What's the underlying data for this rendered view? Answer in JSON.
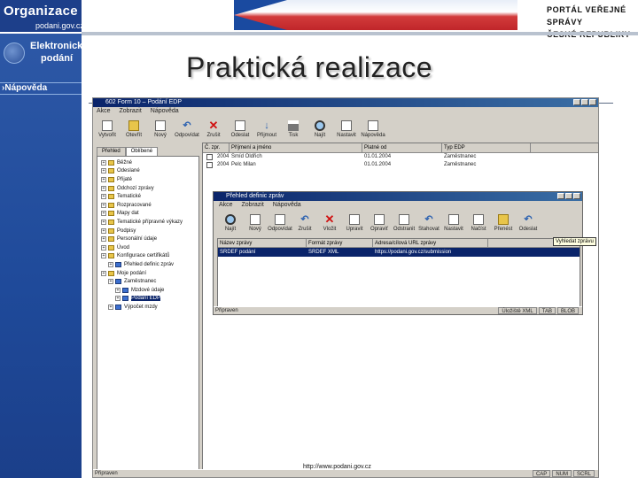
{
  "header": {
    "org_title": "Organizace",
    "org_domain": "podani.gov.cz",
    "portal_line1": "PORTÁL VEŘEJNÉ SPRÁVY",
    "portal_line2": "ČESKÉ REPUBLIKY"
  },
  "sidebar": {
    "app_name_line1": "Elektronická",
    "app_name_line2": "podání",
    "help_label": "Nápověda"
  },
  "slide": {
    "title": "Praktická realizace",
    "footer_url": "http://www.podani.gov.cz"
  },
  "main_window": {
    "title": "602 Form 10 – Podání EDP",
    "menu": [
      "Akce",
      "Zobrazit",
      "Nápověda"
    ],
    "toolbar": [
      "Vytvořit",
      "Otevřít",
      "Nový",
      "Odpovídat",
      "Zrušit",
      "Odeslat",
      "Přijmout",
      "Tisk",
      "Najít",
      "Nastavit",
      "Nápověda"
    ],
    "tabs": [
      "Přehled",
      "Oblíbené"
    ],
    "tree": [
      {
        "label": "Běžné",
        "level": 0
      },
      {
        "label": "Odeslané",
        "level": 0
      },
      {
        "label": "Přijaté",
        "level": 0
      },
      {
        "label": "Odchozí zprávy",
        "level": 0
      },
      {
        "label": "Tematické",
        "level": 0
      },
      {
        "label": "Rozpracované",
        "level": 0
      },
      {
        "label": "Mapy dat",
        "level": 0
      },
      {
        "label": "Tematické přípravné výkazy",
        "level": 0
      },
      {
        "label": "Podpisy",
        "level": 0
      },
      {
        "label": "Personální údaje",
        "level": 0
      },
      {
        "label": "Úvod",
        "level": 0
      },
      {
        "label": "Konfigurace certifikátů",
        "level": 0
      },
      {
        "label": "Přehled definic zpráv",
        "level": 1
      },
      {
        "label": "Moje podání",
        "level": 0
      },
      {
        "label": "Zaměstnanec",
        "level": 1
      },
      {
        "label": "Mzdové údaje",
        "level": 2
      },
      {
        "label": "Podání EDP",
        "level": 2,
        "selected": true
      },
      {
        "label": "Výpočet mzdy",
        "level": 1
      }
    ],
    "grid_headers": [
      "Č. zpr.",
      "Příjmení a jméno",
      "Platné od",
      "Typ EDP"
    ],
    "grid_rows": [
      [
        "2004",
        "Šmíd Oldřich",
        "01.01.2004",
        "Zaměstnanec"
      ],
      [
        "2004",
        "Pelc Milan",
        "01.01.2004",
        "Zaměstnanec"
      ]
    ],
    "status": "Připraven",
    "status_cells": [
      "CAP",
      "NUM",
      "SCRL"
    ]
  },
  "dialog": {
    "title": "Přehled definic zpráv",
    "menu": [
      "Akce",
      "Zobrazit",
      "Nápověda"
    ],
    "toolbar": [
      "Najít",
      "Nový",
      "Odpovídat",
      "Zrušit",
      "Vložit",
      "Upravit",
      "Opraviť",
      "Odstranit",
      "Stahovat",
      "Nastavit",
      "Načíst",
      "Přenést",
      "Odeslat"
    ],
    "grid_headers": [
      "Název zprávy",
      "Formát zprávy",
      "Adresa/cílová URL zprávy"
    ],
    "grid_rows": [
      [
        "SRDEF podání",
        "SRDEF XML",
        "https://podani.gov.cz/submission"
      ]
    ],
    "status": "Připraven",
    "status_cells": [
      "Úložiště XML",
      "TAB",
      "BLOB"
    ],
    "tooltip": "Vyhledat zprávu"
  }
}
